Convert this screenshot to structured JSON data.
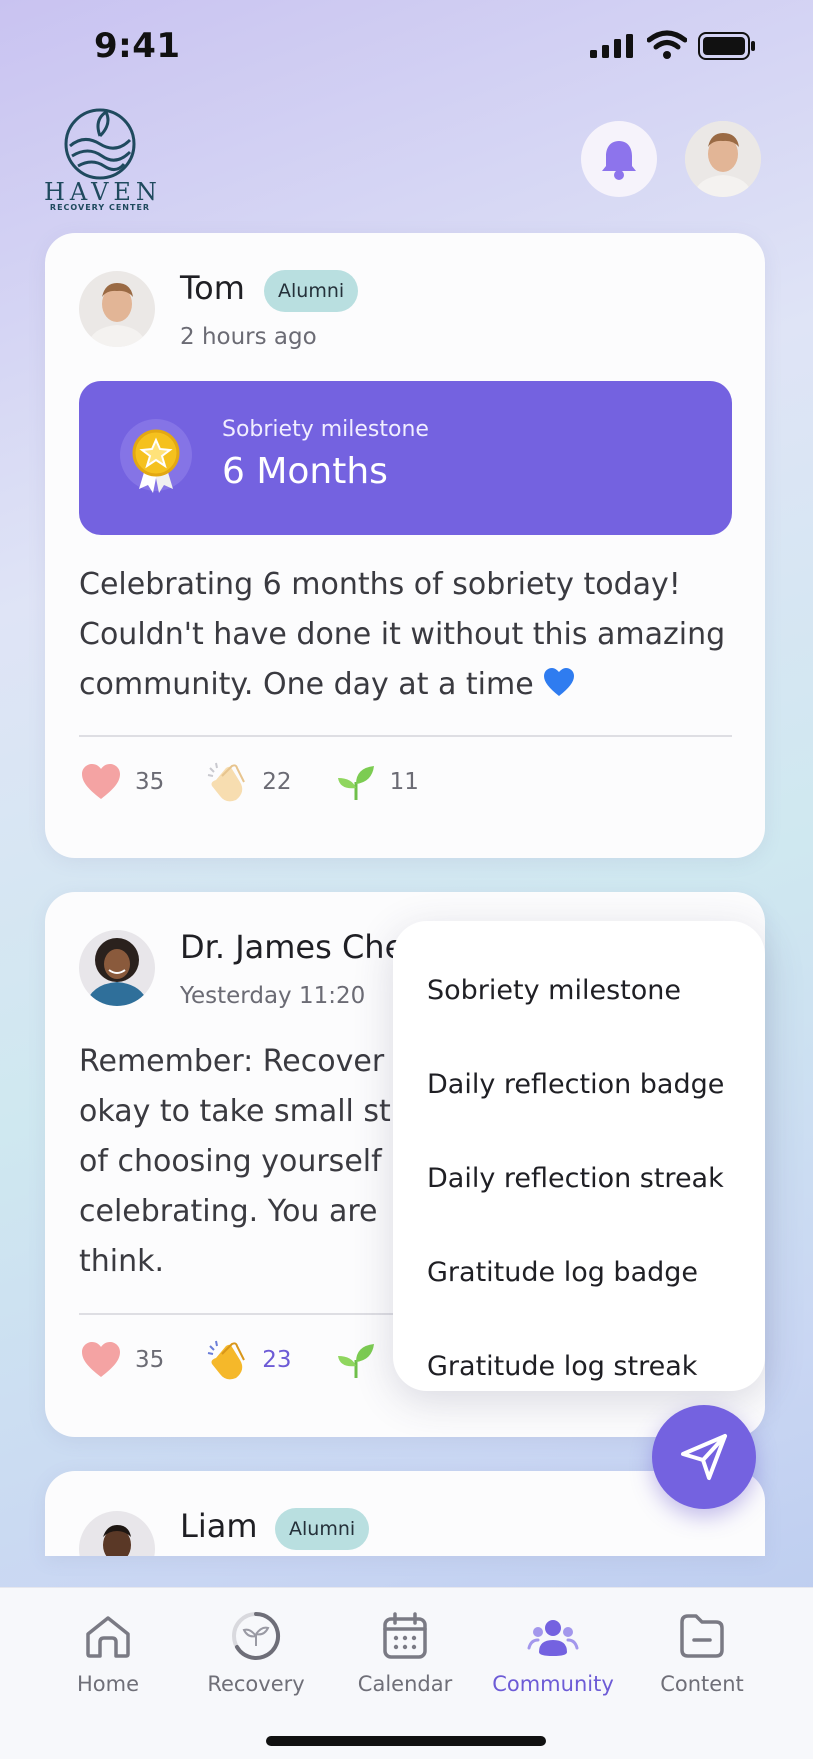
{
  "status_bar": {
    "time": "9:41"
  },
  "header": {
    "logo_text": "HAVEN",
    "logo_subtext": "RECOVERY CENTER"
  },
  "posts": [
    {
      "author": "Tom",
      "badge": "Alumni",
      "time": "2 hours ago",
      "milestone": {
        "label": "Sobriety milestone",
        "value": "6 Months"
      },
      "text": "Celebrating 6 months of sobriety today! Couldn't have done it without this amazing community. One day at a time",
      "reactions": {
        "heart": "35",
        "clap": "22",
        "sprout": "11"
      }
    },
    {
      "author": "Dr. James Che",
      "time": "Yesterday 11:20",
      "text_lines": [
        "Remember: Recover",
        "okay to take small st",
        "of choosing yourself",
        "celebrating. You are",
        "think."
      ],
      "reactions": {
        "heart": "35",
        "clap": "23"
      }
    },
    {
      "author": "Liam",
      "badge": "Alumni"
    }
  ],
  "menu": {
    "items": [
      "Sobriety milestone",
      "Daily reflection badge",
      "Daily reflection streak",
      "Gratitude log badge",
      "Gratitude log streak"
    ]
  },
  "nav": {
    "items": [
      "Home",
      "Recovery",
      "Calendar",
      "Community",
      "Content"
    ],
    "active": "Community"
  },
  "colors": {
    "accent": "#7462e0",
    "badge": "#b9dfe0",
    "heart": "#f29a9a"
  }
}
